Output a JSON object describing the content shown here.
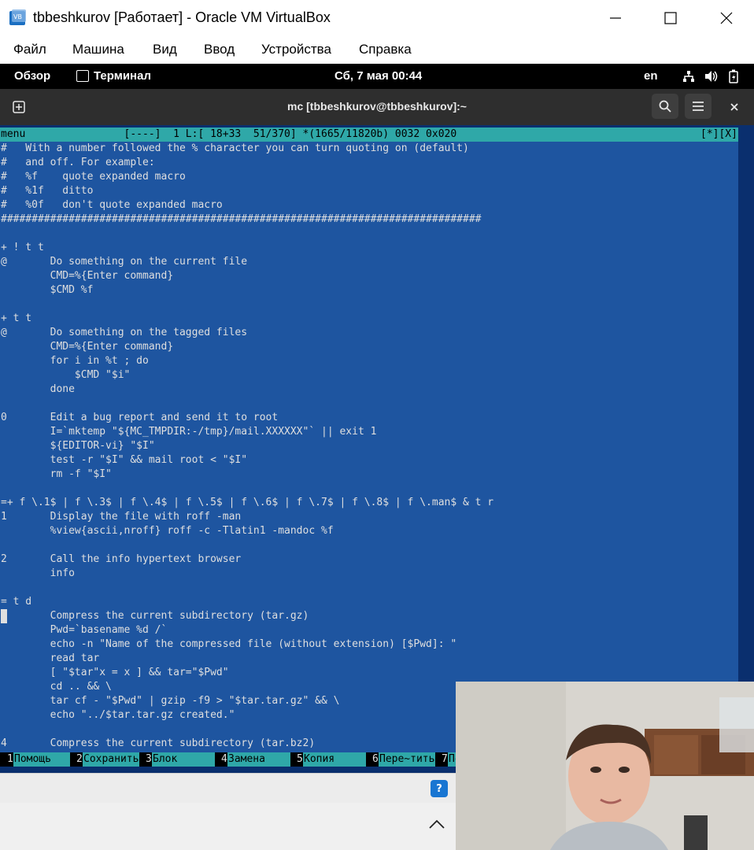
{
  "window": {
    "title": "tbbeshkurov [Работает] - Oracle VM VirtualBox",
    "icon": "virtualbox-icon"
  },
  "menu": {
    "file": "Файл",
    "machine": "Машина",
    "view": "Вид",
    "input": "Ввод",
    "devices": "Устройства",
    "help": "Справка"
  },
  "gnome": {
    "overview": "Обзор",
    "app": "Терминал",
    "clock": "Сб, 7 мая  00:44",
    "lang": "en"
  },
  "terminal": {
    "title": "mc [tbbeshkurov@tbbeshkurov]:~"
  },
  "editor": {
    "status": "menu                [----]  1 L:[ 18+33  51/370] *(1665/11820b) 0032 0x020",
    "status_right": "[*][X]",
    "lines": [
      "#   With a number followed the % character you can turn quoting on (default)",
      "#   and off. For example:",
      "#   %f    quote expanded macro",
      "#   %1f   ditto",
      "#   %0f   don't quote expanded macro",
      "##############################################################################",
      "",
      "+ ! t t",
      "@       Do something on the current file",
      "        CMD=%{Enter command}",
      "        $CMD %f",
      "",
      "+ t t",
      "@       Do something on the tagged files",
      "        CMD=%{Enter command}",
      "        for i in %t ; do",
      "            $CMD \"$i\"",
      "        done",
      "",
      "0       Edit a bug report and send it to root",
      "        I=`mktemp \"${MC_TMPDIR:-/tmp}/mail.XXXXXX\"` || exit 1",
      "        ${EDITOR-vi} \"$I\"",
      "        test -r \"$I\" && mail root < \"$I\"",
      "        rm -f \"$I\"",
      "",
      "=+ f \\.1$ | f \\.3$ | f \\.4$ | f \\.5$ | f \\.6$ | f \\.7$ | f \\.8$ | f \\.man$ & t r",
      "1       Display the file with roff -man",
      "        %view{ascii,nroff} roff -c -Tlatin1 -mandoc %f",
      "",
      "2       Call the info hypertext browser",
      "        info",
      "",
      "= t d",
      "3       Compress the current subdirectory (tar.gz)",
      "        Pwd=`basename %d /`",
      "        echo -n \"Name of the compressed file (without extension) [$Pwd]: \"",
      "        read tar",
      "        [ \"$tar\"x = x ] && tar=\"$Pwd\"",
      "        cd .. && \\",
      "        tar cf - \"$Pwd\" | gzip -f9 > \"$tar.tar.gz\" && \\",
      "        echo \"../$tar.tar.gz created.\"",
      "",
      "4       Compress the current subdirectory (tar.bz2)"
    ]
  },
  "fkeys": [
    {
      "num": "1",
      "label": "Помощь"
    },
    {
      "num": "2",
      "label": "Сохранить"
    },
    {
      "num": "3",
      "label": "Блок"
    },
    {
      "num": "4",
      "label": "Замена"
    },
    {
      "num": "5",
      "label": "Копия"
    },
    {
      "num": "6",
      "label": "Пере~тить"
    },
    {
      "num": "7",
      "label": "По"
    }
  ],
  "colors": {
    "editor_bg": "#1e55a0",
    "status_bg": "#2fa8a8",
    "gnome_bar": "#000000",
    "terminal_header": "#2e2e2e"
  }
}
